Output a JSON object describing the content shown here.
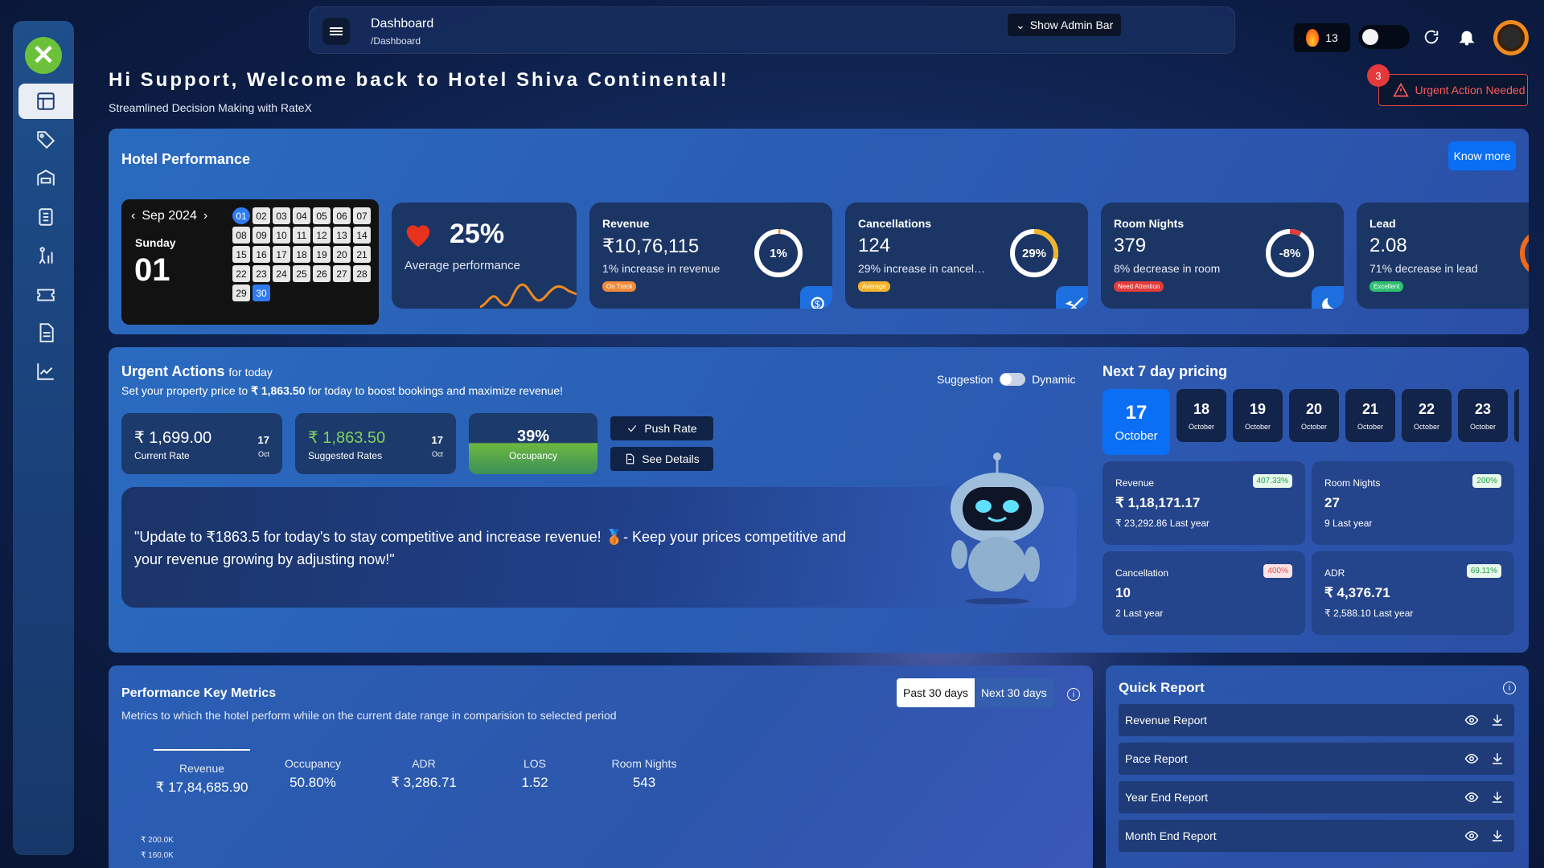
{
  "topbar": {
    "title": "Dashboard",
    "breadcrumb": "/Dashboard",
    "admin_bar_label": "Show Admin Bar",
    "streak_count": "13"
  },
  "welcome": {
    "title": "Hi Support, Welcome back to Hotel Shiva Continental!",
    "subtitle": "Streamlined Decision Making with RateX"
  },
  "urgent": {
    "label": "Urgent Action Needed",
    "count": "3"
  },
  "sidebar": {
    "items": [
      {
        "icon": "dashboard-icon",
        "active": true
      },
      {
        "icon": "tags-icon"
      },
      {
        "icon": "hotel-icon"
      },
      {
        "icon": "rate-icon"
      },
      {
        "icon": "analytics-person-icon"
      },
      {
        "icon": "ticket-icon"
      },
      {
        "icon": "report-icon"
      },
      {
        "icon": "trend-chart-icon"
      }
    ]
  },
  "hotel_performance": {
    "title": "Hotel Performance",
    "know_more": "Know more",
    "calendar": {
      "month": "Sep 2024",
      "weekday": "Sunday",
      "date": "01",
      "days": [
        "01",
        "02",
        "03",
        "04",
        "05",
        "06",
        "07",
        "08",
        "09",
        "10",
        "11",
        "12",
        "13",
        "14",
        "15",
        "16",
        "17",
        "18",
        "19",
        "20",
        "21",
        "22",
        "23",
        "24",
        "25",
        "26",
        "27",
        "28",
        "29",
        "30"
      ]
    },
    "average": {
      "percent": "25%",
      "label": "Average performance"
    },
    "kpis": [
      {
        "title": "Revenue",
        "value": "₹10,76,115",
        "desc": "1% increase in revenue",
        "ring": "1%",
        "ring_fraction": 0.01,
        "tag": "On Track",
        "tag_color": "#f08a3a"
      },
      {
        "title": "Cancellations",
        "value": "124",
        "desc": "29% increase in cancellations",
        "ring": "29%",
        "ring_fraction": 0.29,
        "tag": "Average",
        "tag_color": "#f2b42c"
      },
      {
        "title": "Room Nights",
        "value": "379",
        "desc": "8% decrease in room",
        "ring": "-8%",
        "ring_fraction": 0.08,
        "tag": "Need Attention",
        "tag_color": "#e23b3b"
      },
      {
        "title": "Lead",
        "value": "2.08",
        "desc": "71% decrease in lead",
        "tag": "Excellent",
        "tag_color": "#2fbf71"
      }
    ]
  },
  "urgent_actions": {
    "title": "Urgent Actions",
    "title_suffix": "for today",
    "desc_prefix": "Set your property price to",
    "desc_price": "₹ 1,863.50",
    "desc_suffix": "for today to boost bookings and maximize revenue!",
    "suggestion_label": "Suggestion",
    "dynamic_label": "Dynamic",
    "current_rate": {
      "value": "₹ 1,699.00",
      "label": "Current Rate",
      "day": "17",
      "month": "Oct"
    },
    "suggested_rate": {
      "value": "₹ 1,863.50",
      "label": "Suggested Rates",
      "day": "17",
      "month": "Oct"
    },
    "occupancy": {
      "value": "39%",
      "label": "Occupancy"
    },
    "push_rate": "Push Rate",
    "see_details": "See Details",
    "quote": "\"Update to ₹1863.5 for today's to stay competitive and increase revenue! 🥉- Keep your prices competitive and your revenue growing by adjusting now!\""
  },
  "next7": {
    "title": "Next 7 day pricing",
    "days": [
      {
        "d": "17",
        "m": "October",
        "active": true
      },
      {
        "d": "18",
        "m": "October"
      },
      {
        "d": "19",
        "m": "October"
      },
      {
        "d": "20",
        "m": "October"
      },
      {
        "d": "21",
        "m": "October"
      },
      {
        "d": "22",
        "m": "October"
      },
      {
        "d": "23",
        "m": "October"
      }
    ],
    "stats": [
      {
        "label": "Revenue",
        "value": "₹ 1,18,171.17",
        "sub": "₹ 23,292.86 Last year",
        "badge": "407.33%",
        "neg": false
      },
      {
        "label": "Room Nights",
        "value": "27",
        "sub": "9 Last year",
        "badge": "200%",
        "neg": false
      },
      {
        "label": "Cancellation",
        "value": "10",
        "sub": "2 Last year",
        "badge": "400%",
        "neg": true
      },
      {
        "label": "ADR",
        "value": "₹ 4,376.71",
        "sub": "₹ 2,588.10 Last year",
        "badge": "69.11%",
        "neg": false
      }
    ]
  },
  "pkm": {
    "title": "Performance Key Metrics",
    "desc": "Metrics to which the hotel perform while on the current date range in comparision to selected period",
    "past": "Past 30 days",
    "next": "Next 30 days",
    "metrics": [
      {
        "label": "Revenue",
        "value": "₹ 17,84,685.90"
      },
      {
        "label": "Occupancy",
        "value": "50.80%"
      },
      {
        "label": "ADR",
        "value": "₹ 3,286.71"
      },
      {
        "label": "LOS",
        "value": "1.52"
      },
      {
        "label": "Room Nights",
        "value": "543"
      }
    ],
    "axis": [
      "₹ 200.0K",
      "₹ 160.0K"
    ]
  },
  "quick_report": {
    "title": "Quick Report",
    "items": [
      "Revenue Report",
      "Pace Report",
      "Year End Report",
      "Month End Report"
    ]
  }
}
